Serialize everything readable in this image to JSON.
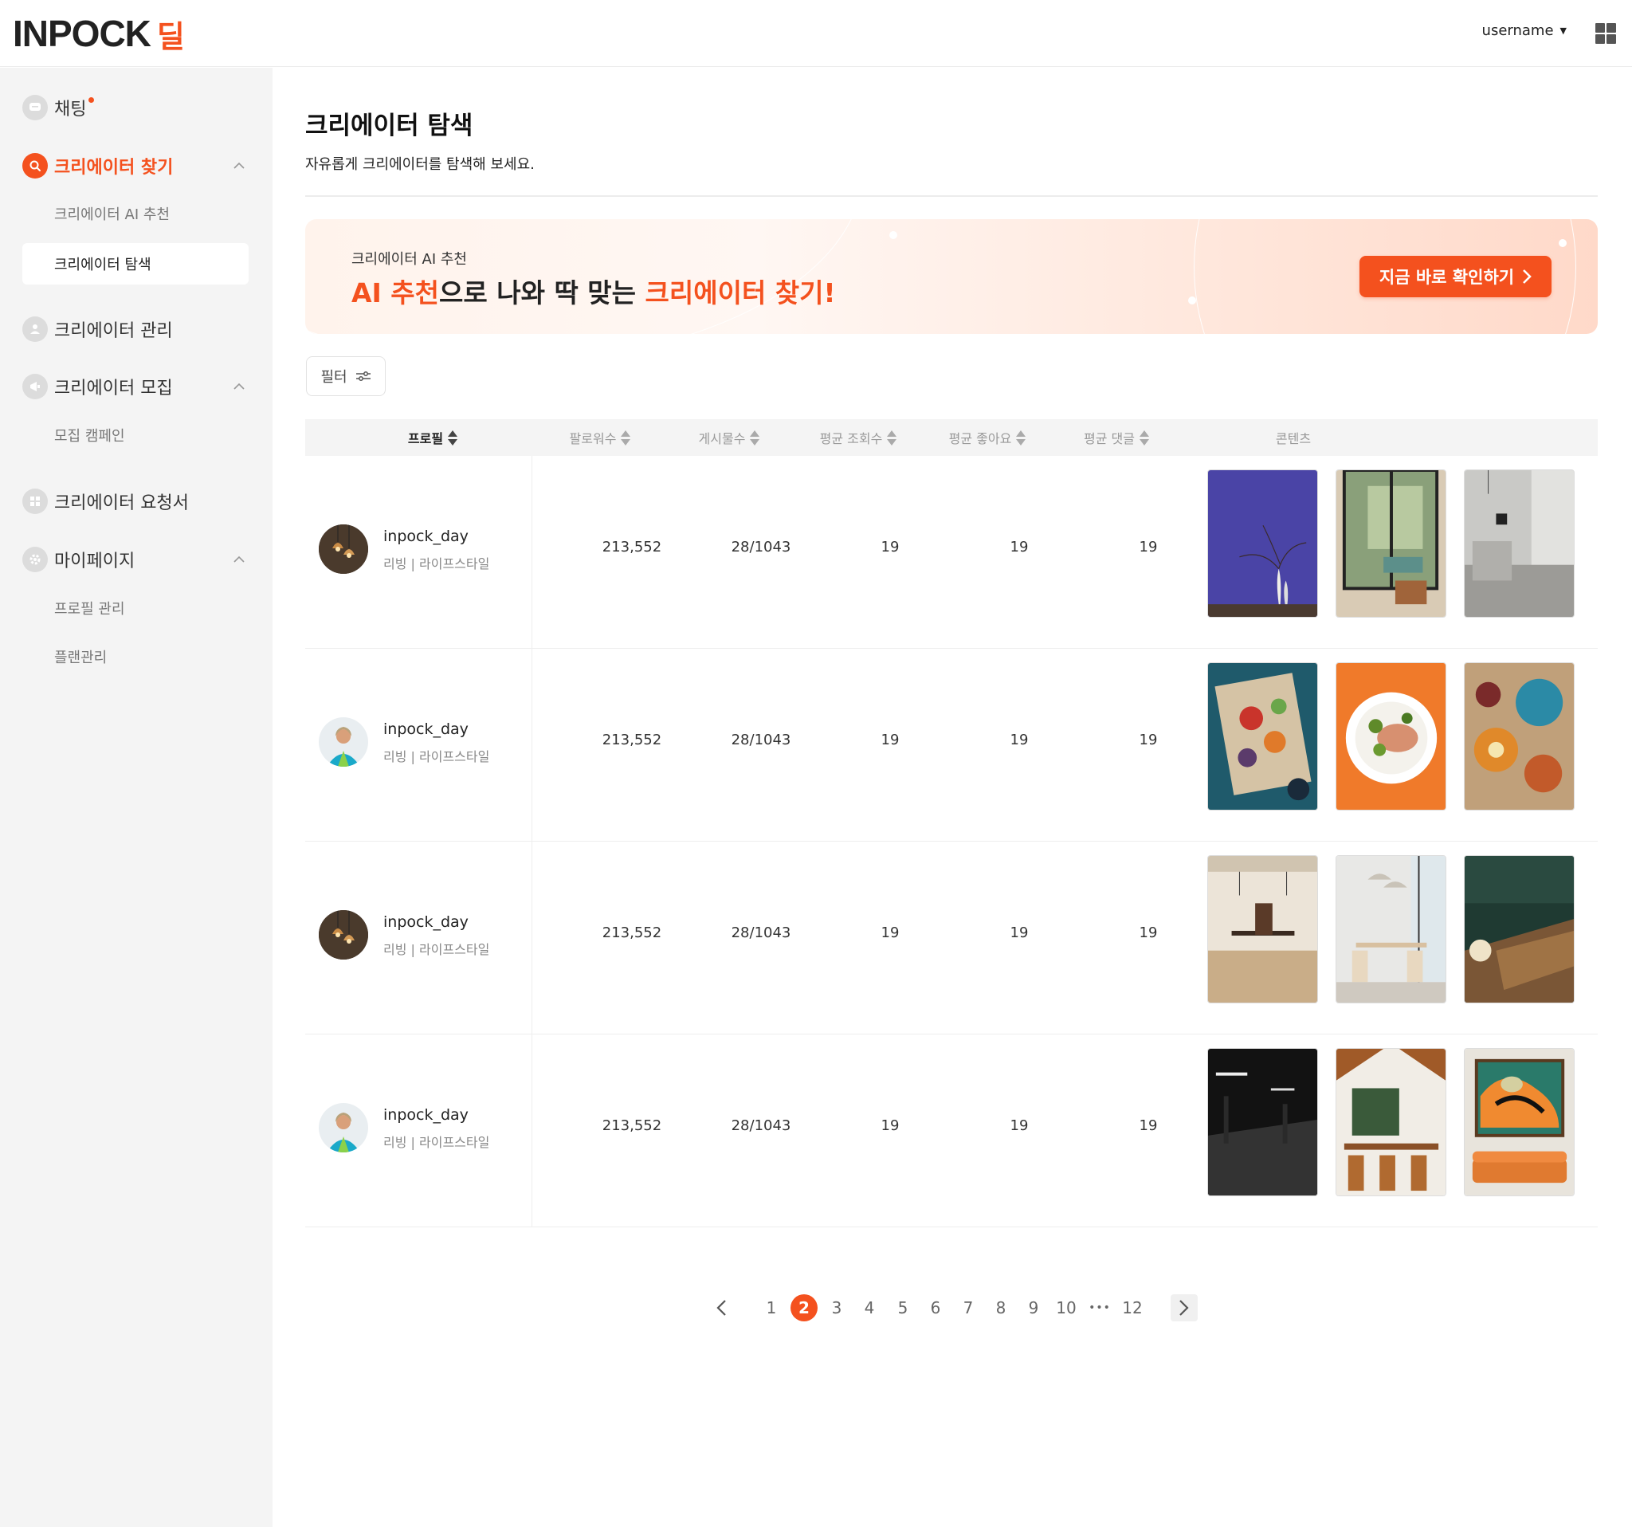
{
  "header": {
    "logo_main": "INPOCK",
    "logo_deal": "딜",
    "username": "username"
  },
  "sidebar": {
    "chat": "채팅",
    "find": "크리에이터 찾기",
    "find_ai": "크리에이터 AI 추천",
    "find_search": "크리에이터 탐색",
    "manage": "크리에이터 관리",
    "recruit": "크리에이터 모집",
    "recruit_campaign": "모집 캠페인",
    "request": "크리에이터 요청서",
    "mypage": "마이페이지",
    "profile": "프로필 관리",
    "plan": "플랜관리"
  },
  "main": {
    "title": "크리에이터 탐색",
    "subtitle": "자유롭게 크리에이터를 탐색해 보세요."
  },
  "banner": {
    "small": "크리에이터 AI 추천",
    "big_part1": "AI 추천",
    "big_part2": "으로 나와 딱 맞는 ",
    "big_part3": "크리에이터 찾기!",
    "button": "지금 바로 확인하기"
  },
  "filter": {
    "label": "필터"
  },
  "table": {
    "columns": [
      "프로필",
      "팔로워수",
      "게시물수",
      "평균 조회수",
      "평균 좋아요",
      "평균 댓글",
      "콘텐츠"
    ],
    "rows": [
      {
        "name": "inpock_day",
        "category": "리빙 | 라이프스타일",
        "followers": "213,552",
        "posts": "28/1043",
        "views": "19",
        "likes": "19",
        "comments": "19",
        "avatar": "lamps",
        "thumbs": [
          "purple-vase",
          "glass-door-patio",
          "grey-kitchen"
        ]
      },
      {
        "name": "inpock_day",
        "category": "리빙 | 라이프스타일",
        "followers": "213,552",
        "posts": "28/1043",
        "views": "19",
        "likes": "19",
        "comments": "19",
        "avatar": "woman-blue",
        "thumbs": [
          "food-platter-teal",
          "salmon-plate-orange",
          "food-table-top"
        ]
      },
      {
        "name": "inpock_day",
        "category": "리빙 | 라이프스타일",
        "followers": "213,552",
        "posts": "28/1043",
        "views": "19",
        "likes": "19",
        "comments": "19",
        "avatar": "lamps",
        "thumbs": [
          "wood-dining-room",
          "bright-dining-room",
          "green-cabinet-table"
        ]
      },
      {
        "name": "inpock_day",
        "category": "리빙 | 라이프스타일",
        "followers": "213,552",
        "posts": "28/1043",
        "views": "19",
        "likes": "19",
        "comments": "19",
        "avatar": "woman-blue",
        "thumbs": [
          "dark-garage",
          "wood-cafe",
          "abstract-art-sofa"
        ]
      }
    ]
  },
  "pagination": {
    "pages": [
      "1",
      "2",
      "3",
      "4",
      "5",
      "6",
      "7",
      "8",
      "9",
      "10"
    ],
    "last": "12",
    "active": "2",
    "ellipsis": "•••"
  },
  "colors": {
    "accent": "#f4511e",
    "sidebar_bg": "#f4f4f4"
  }
}
